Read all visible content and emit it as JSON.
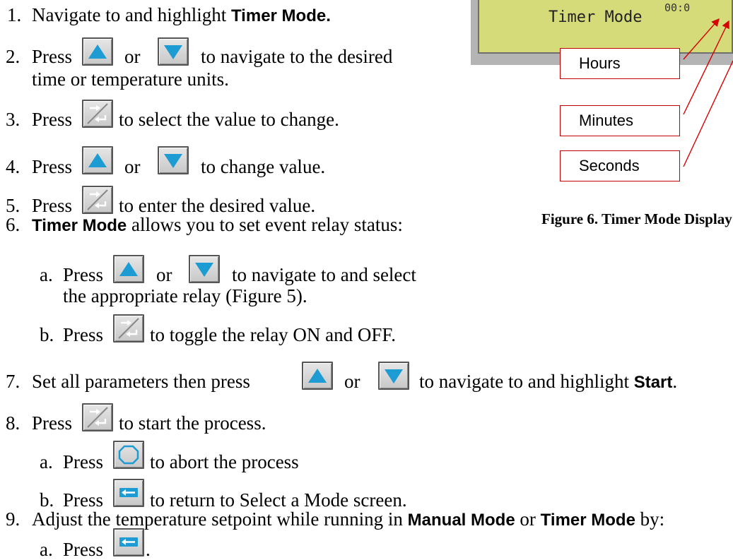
{
  "steps": {
    "s1": {
      "num": "1.",
      "pre": "Navigate to and highlight ",
      "bold": "Timer Mode."
    },
    "s2": {
      "num": "2.",
      "press": "Press",
      "or": "or",
      "post": "to navigate to the desired",
      "cont": "time or temperature units."
    },
    "s3": {
      "num": "3.",
      "press": "Press",
      "post": "to select the value to change."
    },
    "s4": {
      "num": "4.",
      "press": "Press",
      "or": "or",
      "post": "to change value."
    },
    "s5": {
      "num": "5.",
      "press": "Press",
      "post": "to enter the desired value."
    },
    "s6": {
      "num": "6.",
      "bold": "Timer Mode",
      "post": " allows you to set event relay status:"
    },
    "s6a": {
      "num": "a.",
      "press": "Press",
      "or": "or",
      "post": "to navigate to and select",
      "cont": "the appropriate relay (Figure 5)."
    },
    "s6b": {
      "num": "b.",
      "press": "Press",
      "post": "to toggle the relay ON and OFF."
    },
    "s7": {
      "num": "7.",
      "pre": "Set all parameters then press",
      "or": "or",
      "post": "to navigate to and highlight ",
      "bold": "Start",
      "end": "."
    },
    "s8": {
      "num": "8.",
      "press": "Press",
      "post": "to start the process."
    },
    "s8a": {
      "num": "a.",
      "press": "Press",
      "post": "to abort the process"
    },
    "s8b": {
      "num": "b.",
      "press": "Press",
      "post": "to return to Select a Mode screen."
    },
    "s9": {
      "num": "9.",
      "pre": "Adjust the temperature setpoint while running in ",
      "bold1": "Manual Mode",
      "mid": " or ",
      "bold2": "Timer Mode",
      "post": " by:"
    },
    "s9a": {
      "num": "a.",
      "press": "Press",
      "end": "."
    }
  },
  "figure": {
    "lcd_label": "Timer Mode",
    "lcd_value": "00:0",
    "callouts": {
      "hours": "Hours",
      "minutes": "Minutes",
      "seconds": "Seconds"
    },
    "caption": "Figure 6. Timer Mode Display",
    "lcd_color": "#d6db7a",
    "arrow_color": "#d40000"
  }
}
